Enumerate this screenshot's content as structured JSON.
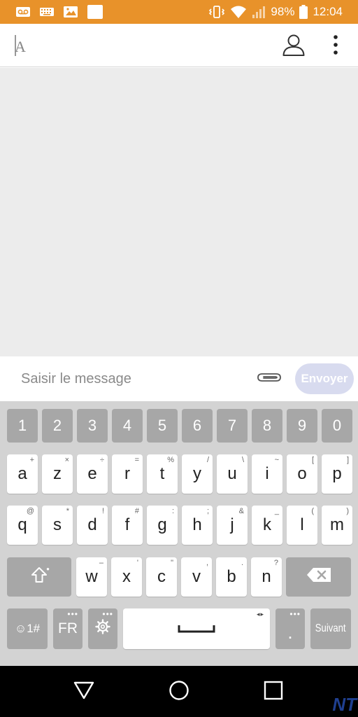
{
  "status_bar": {
    "battery_percent": "98%",
    "time": "12:04",
    "left_icons": [
      "voicemail-icon",
      "keyboard-icon",
      "image-icon",
      "blank-square-icon"
    ],
    "right_icons": [
      "vibrate-icon",
      "wifi-icon",
      "signal-icon",
      "battery-icon"
    ]
  },
  "app_bar": {
    "recipient_placeholder": "",
    "contact_icon": "person-icon",
    "overflow_icon": "more-vert-icon"
  },
  "compose": {
    "placeholder": "Saisir le message",
    "attach_icon": "paperclip-icon",
    "send_label": "Envoyer"
  },
  "keyboard": {
    "number_row": [
      "1",
      "2",
      "3",
      "4",
      "5",
      "6",
      "7",
      "8",
      "9",
      "0"
    ],
    "row1": [
      {
        "key": "a",
        "hint": "+"
      },
      {
        "key": "z",
        "hint": "×"
      },
      {
        "key": "e",
        "hint": "÷"
      },
      {
        "key": "r",
        "hint": "="
      },
      {
        "key": "t",
        "hint": "%"
      },
      {
        "key": "y",
        "hint": "/"
      },
      {
        "key": "u",
        "hint": "\\"
      },
      {
        "key": "i",
        "hint": "~"
      },
      {
        "key": "o",
        "hint": "["
      },
      {
        "key": "p",
        "hint": "]"
      }
    ],
    "row2": [
      {
        "key": "q",
        "hint": "@"
      },
      {
        "key": "s",
        "hint": "*"
      },
      {
        "key": "d",
        "hint": "!"
      },
      {
        "key": "f",
        "hint": "#"
      },
      {
        "key": "g",
        "hint": ":"
      },
      {
        "key": "h",
        "hint": ";"
      },
      {
        "key": "j",
        "hint": "&"
      },
      {
        "key": "k",
        "hint": "_"
      },
      {
        "key": "l",
        "hint": "("
      },
      {
        "key": "m",
        "hint": ")"
      }
    ],
    "row3": [
      {
        "key": "w",
        "hint": "–"
      },
      {
        "key": "x",
        "hint": "'"
      },
      {
        "key": "c",
        "hint": "\""
      },
      {
        "key": "v",
        "hint": ","
      },
      {
        "key": "b",
        "hint": "."
      },
      {
        "key": "n",
        "hint": "?"
      }
    ],
    "symbols_label": "☺1#",
    "language_label": "FR",
    "settings_icon": "gear-icon",
    "space_hint": "◂▸",
    "period_label": ".",
    "next_label": "Suivant",
    "shift_icon": "shift-icon",
    "backspace_icon": "backspace-icon"
  },
  "nav_bar": {
    "back_icon": "back-triangle-icon",
    "home_icon": "home-circle-icon",
    "recents_icon": "recents-square-icon",
    "watermark": "NT"
  },
  "colors": {
    "status_bar": "#e8922a",
    "send_button": "#d8dbef",
    "conversation_bg": "#ececec",
    "keyboard_bg": "#d3d3d3"
  }
}
